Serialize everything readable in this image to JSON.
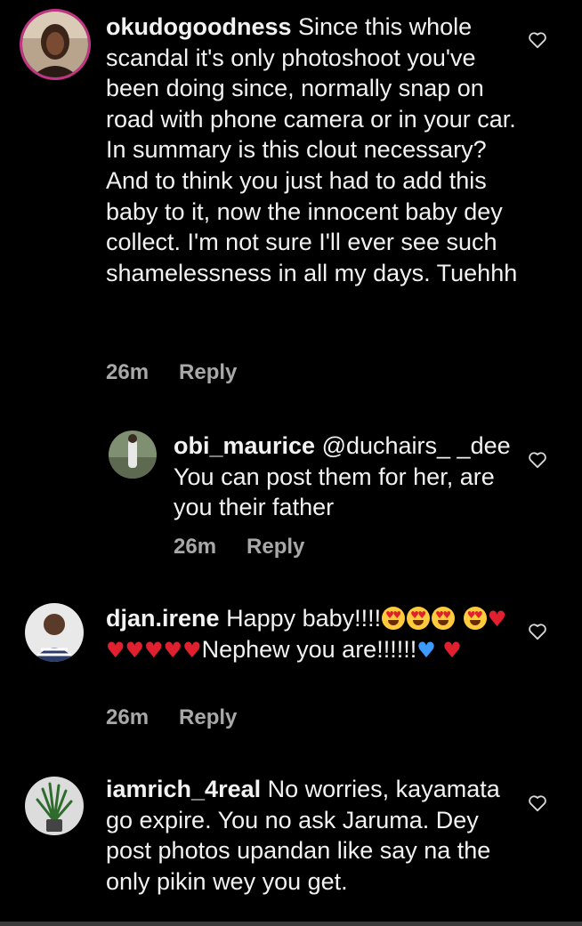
{
  "colors": {
    "background": "#000000",
    "text": "#f2f2f2",
    "meta": "#a8a8a8",
    "story_ring": "#c13584",
    "red_heart": "#e0202e",
    "blue_heart": "#3d9bff"
  },
  "comments": [
    {
      "username": "okudogoodness",
      "body": "Since this whole scandal it's only photoshoot you've been doing since, normally snap on road with phone camera or in your car. In summary is this clout necessary? And to think you just had to add this baby to it, now the innocent baby dey collect. I'm not sure I'll ever see such shamelessness in all my days. Tuehhh",
      "time": "26m",
      "reply_label": "Reply",
      "like_icon": "heart-outline-icon"
    },
    {
      "username": "obi_maurice",
      "body": "@duchairs_ _dee You can post them for her, are you their father",
      "time": "26m",
      "reply_label": "Reply",
      "like_icon": "heart-outline-icon"
    },
    {
      "username": "djan.irene",
      "body_start": "Happy  baby!!!!",
      "body_middle": "Nephew you are!!!!!!",
      "time": "26m",
      "reply_label": "Reply",
      "like_icon": "heart-outline-icon",
      "emojis": [
        "heart-eyes-emoji",
        "red-heart-emoji",
        "blue-heart-emoji"
      ]
    },
    {
      "username": "iamrich_4real",
      "body": "No worries, kayamata go expire. You no ask Jaruma. Dey post photos upandan like say na the only pikin wey you get.",
      "like_icon": "heart-outline-icon"
    }
  ]
}
